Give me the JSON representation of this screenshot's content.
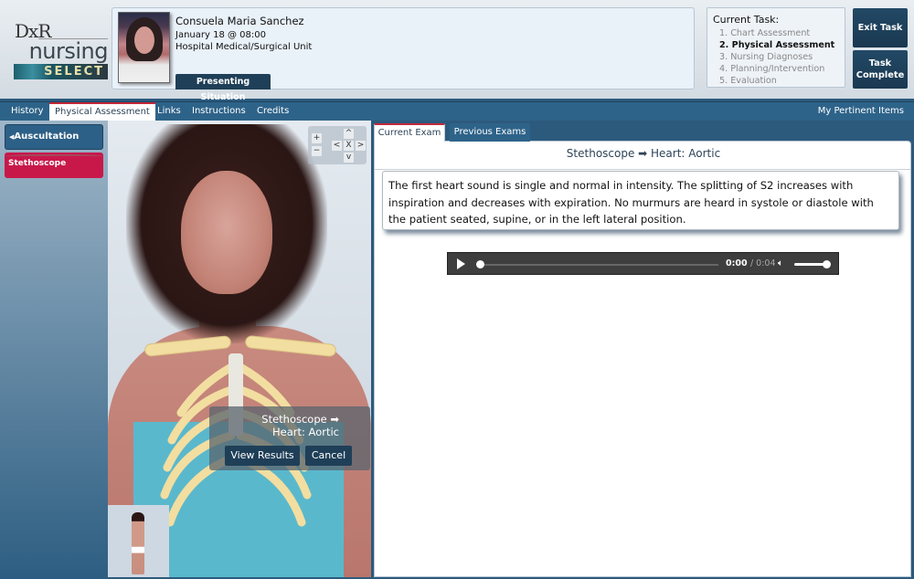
{
  "logo": {
    "line1": "DxR",
    "line2": "nursing",
    "line3": "SELECT"
  },
  "patient": {
    "name": "Consuela Maria Sanchez",
    "datetime": "January 18 @ 08:00",
    "unit": "Hospital Medical/Surgical Unit",
    "presenting_button": "Presenting Situation"
  },
  "task": {
    "title": "Current Task:",
    "items": [
      {
        "label": "1. Chart Assessment",
        "current": false
      },
      {
        "label": "2. Physical Assessment",
        "current": true
      },
      {
        "label": "3. Nursing Diagnoses",
        "current": false
      },
      {
        "label": "4. Planning/Intervention",
        "current": false
      },
      {
        "label": "5. Evaluation",
        "current": false
      }
    ]
  },
  "buttons": {
    "exit": "Exit Task",
    "complete_line1": "Task",
    "complete_line2": "Complete"
  },
  "nav": {
    "tabs": [
      "History",
      "Physical Assessment",
      "Links",
      "Instructions",
      "Credits"
    ],
    "active_tab": "Physical Assessment",
    "right_link": "My Pertinent Items"
  },
  "sidebar": {
    "category": "Auscultation",
    "tool": "Stethoscope"
  },
  "viewer": {
    "zoom_controls": {
      "in": "+",
      "out": "−",
      "up": "^",
      "down": "v",
      "left": "<",
      "right": ">",
      "reset": "X"
    },
    "popup": {
      "line1": "Stethoscope ➡",
      "line2": "Heart: Aortic",
      "view_results": "View Results",
      "cancel": "Cancel"
    }
  },
  "main": {
    "tabs": {
      "current": "Current Exam",
      "previous": "Previous Exams"
    },
    "exam_title": "Stethoscope ➡ Heart: Aortic",
    "result_text": "The first heart sound is single and normal in intensity. The splitting of S2 increases with inspiration and decreases with expiration. No murmurs are heard in systole or diastole with the patient seated, supine, or in the left lateral position.",
    "audio": {
      "current_time": "0:00",
      "duration": "/ 0:04",
      "progress_fraction": 0,
      "volume_fraction": 1
    }
  }
}
